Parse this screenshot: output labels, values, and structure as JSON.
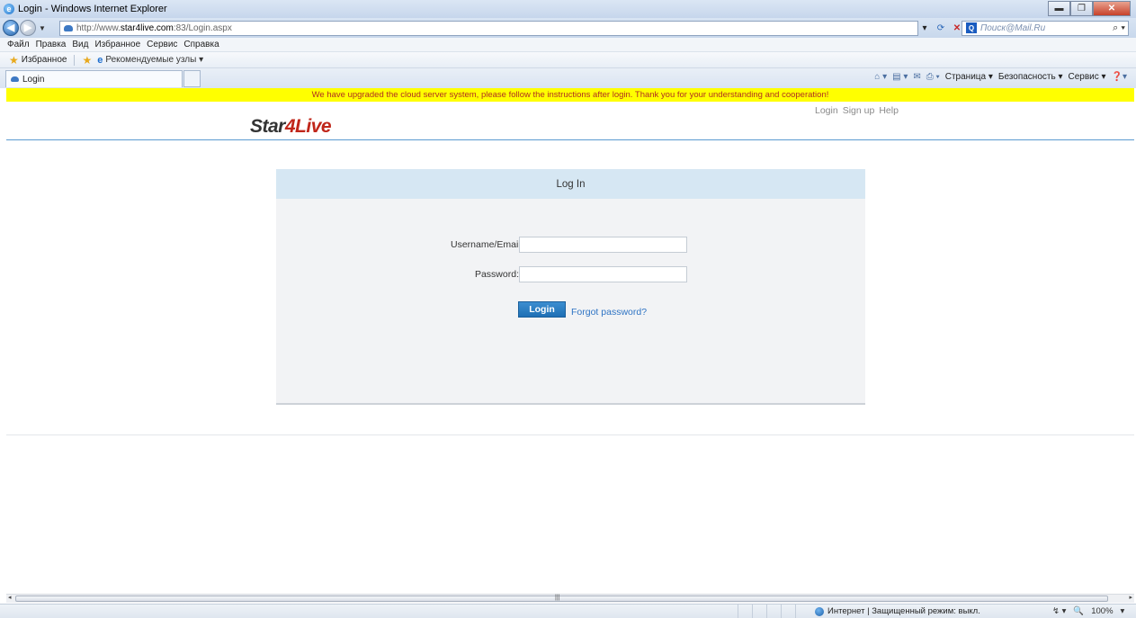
{
  "window": {
    "title": "Login - Windows Internet Explorer",
    "minimize": "▬",
    "maximize": "❐",
    "close": "✕"
  },
  "addressbar": {
    "url_prefix": "http://www.",
    "url_host": "star4live.com",
    "url_rest": ":83/Login.aspx",
    "search_placeholder": "Поиск@Mail.Ru"
  },
  "menu": [
    "Файл",
    "Правка",
    "Вид",
    "Избранное",
    "Сервис",
    "Справка"
  ],
  "favorites": {
    "label": "Избранное",
    "suggested_sites": "Рекомендуемые узлы ▾"
  },
  "tab": {
    "label": "Login"
  },
  "commandbar": {
    "page": "Страница ▾",
    "safety": "Безопасность ▾",
    "tools": "Сервис ▾"
  },
  "notice": "We have upgraded the cloud server system, please follow the instructions after login. Thank you for your understanding and cooperation!",
  "site": {
    "logo_part1": "Star",
    "logo_part2": "4Live",
    "links": [
      "Login",
      "Sign up",
      "Help"
    ]
  },
  "login": {
    "heading": "Log In",
    "username_label": "Username/Email:",
    "username_value": "",
    "password_label": "Password:",
    "password_value": "",
    "login_button": "Login",
    "forgot_link": "Forgot password?"
  },
  "statusbar": {
    "zone": "Интернет | Защищенный режим: выкл.",
    "zoom": "100%"
  }
}
